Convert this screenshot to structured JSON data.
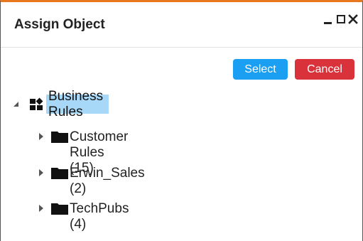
{
  "window": {
    "title": "Assign Object",
    "accent_color": "#e8771e"
  },
  "buttons": {
    "select_label": "Select",
    "select_color": "#1a9ff3",
    "cancel_label": "Cancel",
    "cancel_color": "#d9323a"
  },
  "tree": {
    "root": {
      "label": "Business Rules",
      "icon": "business-rules-icon",
      "expanded": true,
      "selected": true
    },
    "children": [
      {
        "label": "Customer Rules (15)",
        "icon": "folder-icon",
        "expanded": false
      },
      {
        "label": "Erwin_Sales (2)",
        "icon": "folder-icon",
        "expanded": false
      },
      {
        "label": "TechPubs (4)",
        "icon": "folder-icon",
        "expanded": false
      }
    ]
  }
}
